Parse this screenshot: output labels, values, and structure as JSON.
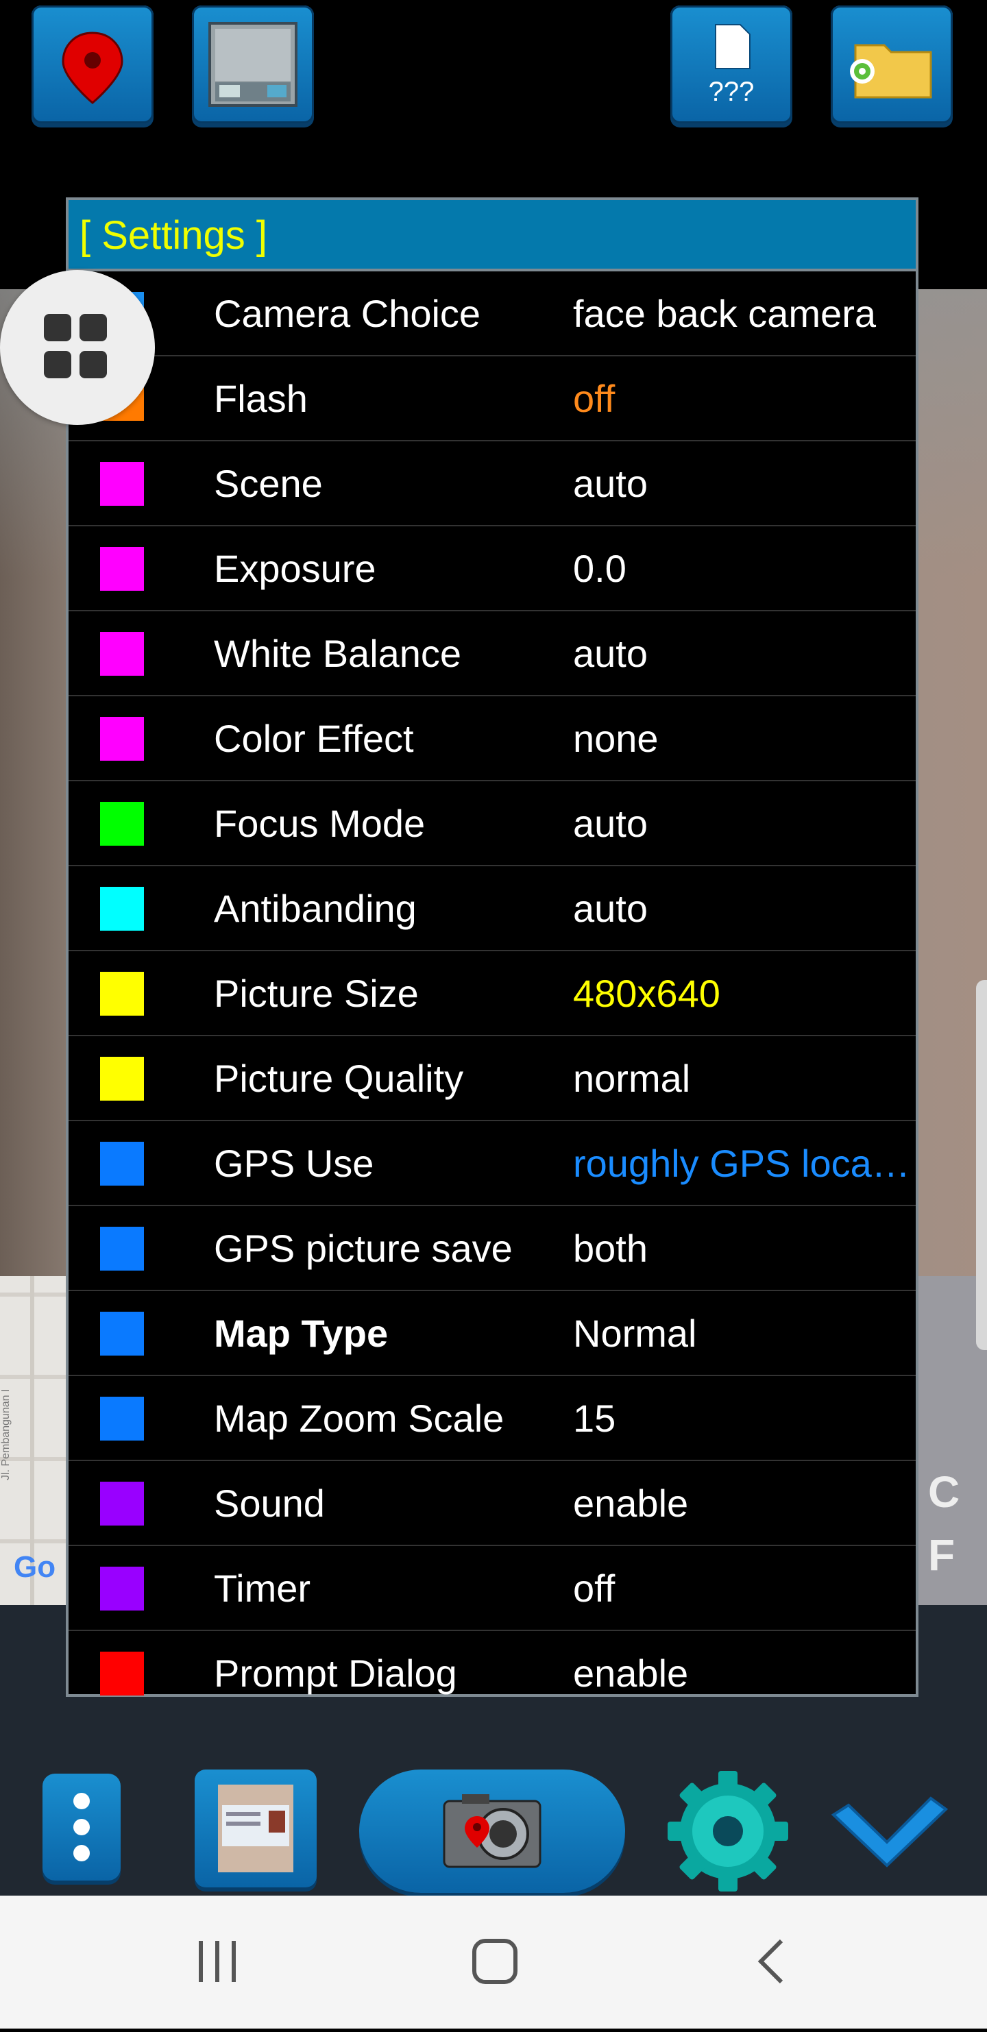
{
  "toolbar": {
    "location_button": "location-pin-icon",
    "camera_info_button": "device-screen-icon",
    "doc_button_label": "???",
    "folder_button": "folder-icon"
  },
  "map": {
    "road_label": "Jl. Pembangunan I",
    "logo_text": "Go"
  },
  "side_letters": [
    "C",
    "F"
  ],
  "settings": {
    "title": "[ Settings ]",
    "rows": [
      {
        "label": "Camera Choice",
        "value": "face back camera",
        "swatch": "#1a8ff0",
        "value_color": "#ffffff",
        "bold": false
      },
      {
        "label": "Flash",
        "value": "off",
        "swatch": "#ff7a00",
        "value_color": "#ff8a1c",
        "bold": false
      },
      {
        "label": "Scene",
        "value": "auto",
        "swatch": "#ff00ff",
        "value_color": "#ffffff",
        "bold": false
      },
      {
        "label": "Exposure",
        "value": "0.0",
        "swatch": "#ff00ff",
        "value_color": "#ffffff",
        "bold": false
      },
      {
        "label": "White Balance",
        "value": "auto",
        "swatch": "#ff00ff",
        "value_color": "#ffffff",
        "bold": false
      },
      {
        "label": "Color Effect",
        "value": "none",
        "swatch": "#ff00ff",
        "value_color": "#ffffff",
        "bold": false
      },
      {
        "label": "Focus Mode",
        "value": "auto",
        "swatch": "#00ff00",
        "value_color": "#ffffff",
        "bold": false
      },
      {
        "label": "Antibanding",
        "value": "auto",
        "swatch": "#00ffff",
        "value_color": "#ffffff",
        "bold": false
      },
      {
        "label": "Picture Size",
        "value": "480x640",
        "swatch": "#ffff00",
        "value_color": "#ffff00",
        "bold": false
      },
      {
        "label": "Picture Quality",
        "value": "normal",
        "swatch": "#ffff00",
        "value_color": "#ffffff",
        "bold": false
      },
      {
        "label": "GPS Use",
        "value": "roughly GPS location",
        "swatch": "#0a7aff",
        "value_color": "#1a8cff",
        "bold": false
      },
      {
        "label": "GPS picture save",
        "value": "both",
        "swatch": "#0a7aff",
        "value_color": "#ffffff",
        "bold": false
      },
      {
        "label": "Map Type",
        "value": "Normal",
        "swatch": "#0a7aff",
        "value_color": "#ffffff",
        "bold": true
      },
      {
        "label": "Map Zoom Scale",
        "value": "15",
        "swatch": "#0a7aff",
        "value_color": "#ffffff",
        "bold": false
      },
      {
        "label": "Sound",
        "value": "enable",
        "swatch": "#9900ff",
        "value_color": "#ffffff",
        "bold": false
      },
      {
        "label": "Timer",
        "value": "off",
        "swatch": "#9900ff",
        "value_color": "#ffffff",
        "bold": false
      },
      {
        "label": "Prompt Dialog",
        "value": "enable",
        "swatch": "#ff0000",
        "value_color": "#ffffff",
        "bold": false
      }
    ]
  },
  "bottom_bar": [
    "more-options-icon",
    "gallery-thumbnail",
    "camera-capture-icon",
    "settings-gear-icon",
    "checkmark-icon"
  ],
  "nav": [
    "recent-apps-icon",
    "home-icon",
    "back-icon"
  ]
}
